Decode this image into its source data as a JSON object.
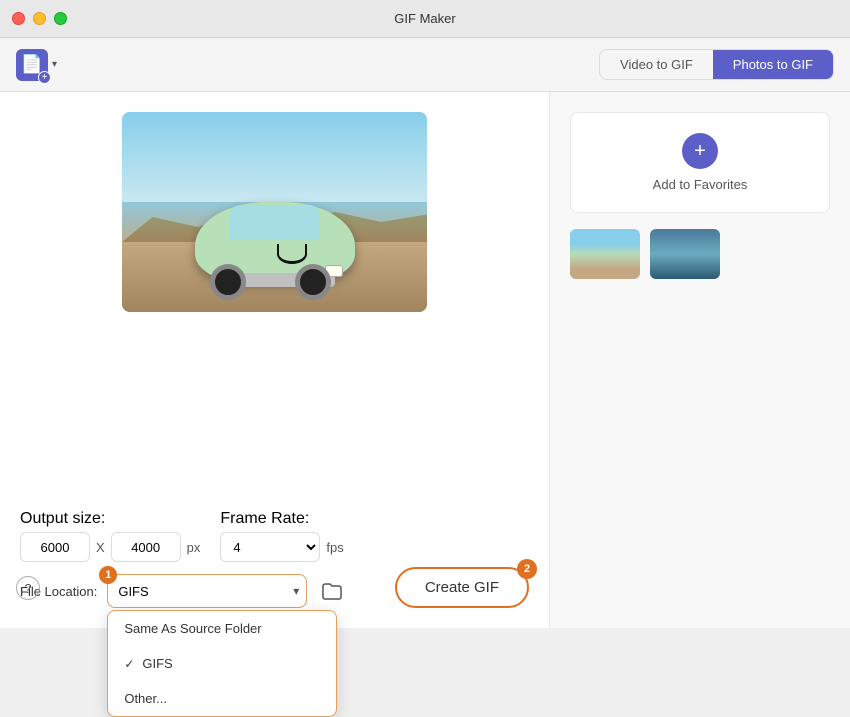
{
  "titleBar": {
    "title": "GIF Maker"
  },
  "toolbar": {
    "importLabel": "",
    "chevron": "▾",
    "tabs": [
      {
        "id": "video-to-gif",
        "label": "Video to GIF",
        "active": false
      },
      {
        "id": "photos-to-gif",
        "label": "Photos to GIF",
        "active": true
      }
    ]
  },
  "rightPanel": {
    "addFavoritesLabel": "Add to Favorites",
    "addFavoritesIcon": "+"
  },
  "settings": {
    "outputSizeLabel": "Output size:",
    "widthValue": "6000",
    "xDivider": "X",
    "heightValue": "4000",
    "pxLabel": "px",
    "frameRateLabel": "Frame Rate:",
    "frameRateValue": "4",
    "fpsLabel": "fps",
    "fileLocationLabel": "File Location:",
    "fileLocationValue": "GIFS",
    "dropdownItems": [
      {
        "label": "Same As Source Folder",
        "checked": false
      },
      {
        "label": "GIFS",
        "checked": true
      },
      {
        "label": "Other...",
        "checked": false
      }
    ]
  },
  "createGifButton": {
    "label": "Create GIF",
    "badge": "2"
  },
  "badges": {
    "fileLocationBadge": "1"
  },
  "helpIcon": "?"
}
